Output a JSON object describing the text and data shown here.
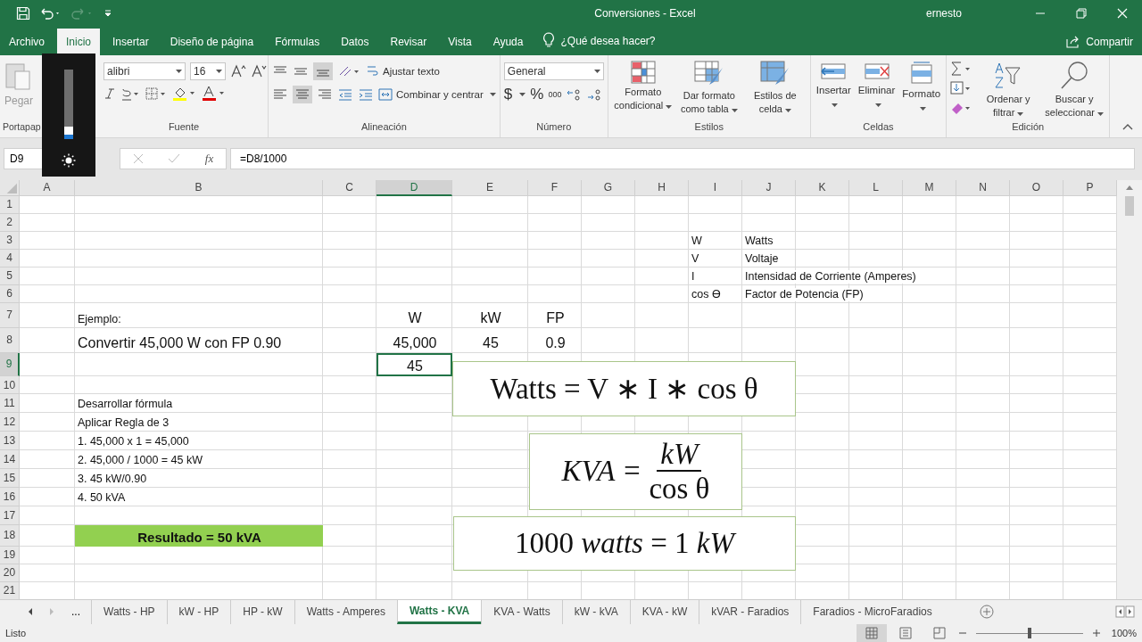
{
  "title_bar": {
    "document_title": "Conversiones  -  Excel",
    "user": "ernesto"
  },
  "ribbon_tabs": [
    {
      "label": "Archivo",
      "selected": false
    },
    {
      "label": "Inicio",
      "selected": true
    },
    {
      "label": "Insertar",
      "selected": false
    },
    {
      "label": "Diseño de página",
      "selected": false
    },
    {
      "label": "Fórmulas",
      "selected": false
    },
    {
      "label": "Datos",
      "selected": false
    },
    {
      "label": "Revisar",
      "selected": false
    },
    {
      "label": "Vista",
      "selected": false
    },
    {
      "label": "Ayuda",
      "selected": false
    }
  ],
  "tell_me": "¿Qué desea hacer?",
  "share": "Compartir",
  "ribbon": {
    "clipboard": {
      "paste": "Pegar",
      "group": "Portapap"
    },
    "font": {
      "name": "alibri",
      "size": "16",
      "group": "Fuente"
    },
    "alignment": {
      "wrap": "Ajustar texto",
      "merge": "Combinar y centrar",
      "group": "Alineación"
    },
    "number": {
      "format": "General",
      "currency": "$",
      "percent": "%",
      "thousands": "000",
      "group": "Número"
    },
    "styles": {
      "buttons": [
        "Formato condicional",
        "Dar formato como tabla",
        "Estilos de celda"
      ],
      "group": "Estilos"
    },
    "cells": {
      "buttons": [
        "Insertar",
        "Eliminar",
        "Formato"
      ],
      "group": "Celdas"
    },
    "editing": {
      "buttons": [
        "Ordenar y filtrar",
        "Buscar y seleccionar"
      ],
      "group": "Edición"
    }
  },
  "formula_bar": {
    "name_box": "D9",
    "function_label": "fx",
    "formula": "=D8/1000"
  },
  "columns": [
    {
      "label": "A",
      "selected": false
    },
    {
      "label": "B",
      "selected": false
    },
    {
      "label": "C",
      "selected": false
    },
    {
      "label": "D",
      "selected": true
    },
    {
      "label": "E",
      "selected": false
    },
    {
      "label": "F",
      "selected": false
    },
    {
      "label": "G",
      "selected": false
    },
    {
      "label": "H",
      "selected": false
    },
    {
      "label": "I",
      "selected": false
    },
    {
      "label": "J",
      "selected": false
    },
    {
      "label": "K",
      "selected": false
    },
    {
      "label": "L",
      "selected": false
    },
    {
      "label": "M",
      "selected": false
    },
    {
      "label": "N",
      "selected": false
    },
    {
      "label": "O",
      "selected": false
    },
    {
      "label": "P",
      "selected": false
    }
  ],
  "rows": [
    {
      "number": "1",
      "kind": "plain",
      "selected": false
    },
    {
      "number": "2",
      "kind": "plain",
      "selected": false
    },
    {
      "number": "3",
      "kind": "plain",
      "selected": false,
      "I": "W",
      "J": "Watts"
    },
    {
      "number": "4",
      "kind": "plain",
      "selected": false,
      "I": "V",
      "J": "Voltaje"
    },
    {
      "number": "5",
      "kind": "plain",
      "selected": false,
      "I": "I",
      "J": "Intensidad de Corriente (Amperes)"
    },
    {
      "number": "6",
      "kind": "plain",
      "selected": false,
      "I": "cos ϴ",
      "J": "Factor de Potencia (FP)"
    },
    {
      "number": "7",
      "kind": "header",
      "selected": false,
      "B": "Ejemplo:",
      "D": "W",
      "E": "kW",
      "F": "FP"
    },
    {
      "number": "8",
      "kind": "values",
      "selected": false,
      "B": "Convertir 45,000 W con FP 0.90",
      "D": "45,000",
      "E": "45",
      "F": "0.9"
    },
    {
      "number": "9",
      "kind": "values",
      "selected": true,
      "D": "45"
    },
    {
      "number": "10",
      "kind": "plain",
      "selected": false
    },
    {
      "number": "11",
      "kind": "plain",
      "selected": false,
      "B": "Desarrollar fórmula"
    },
    {
      "number": "12",
      "kind": "plain",
      "selected": false,
      "B": "Aplicar Regla de 3"
    },
    {
      "number": "13",
      "kind": "plain",
      "selected": false,
      "B": "1. 45,000 x 1 = 45,000"
    },
    {
      "number": "14",
      "kind": "plain",
      "selected": false,
      "B": "2. 45,000 / 1000 = 45 kW"
    },
    {
      "number": "15",
      "kind": "plain",
      "selected": false,
      "B": "3. 45 kW/0.90"
    },
    {
      "number": "16",
      "kind": "plain",
      "selected": false,
      "B": "4. 50 kVA"
    },
    {
      "number": "17",
      "kind": "plain",
      "selected": false
    },
    {
      "number": "18",
      "kind": "result",
      "selected": false,
      "B": "Resultado = 50 kVA"
    },
    {
      "number": "19",
      "kind": "plain",
      "selected": false
    },
    {
      "number": "20",
      "kind": "plain",
      "selected": false
    },
    {
      "number": "21",
      "kind": "plain",
      "selected": false
    }
  ],
  "equations": [
    {
      "kind": "inline",
      "text": "Watts = V ∗ I ∗  cos θ"
    },
    {
      "kind": "fraction",
      "left": "KVA =",
      "numerator": "kW",
      "denominator": "cos θ"
    },
    {
      "kind": "inline",
      "text": "1000 *watts* = 1 *kW*"
    }
  ],
  "sheet_tabs": {
    "more": "...",
    "tabs": [
      {
        "label": "Watts - HP",
        "selected": false
      },
      {
        "label": "kW - HP",
        "selected": false
      },
      {
        "label": "HP - kW",
        "selected": false
      },
      {
        "label": "Watts - Amperes",
        "selected": false
      },
      {
        "label": "Watts - KVA",
        "selected": true
      },
      {
        "label": "KVA - Watts",
        "selected": false
      },
      {
        "label": "kW - kVA",
        "selected": false
      },
      {
        "label": "KVA - kW",
        "selected": false
      },
      {
        "label": "kVAR - Faradios",
        "selected": false
      },
      {
        "label": "Faradios - MicroFaradios",
        "selected": false
      }
    ]
  },
  "status_bar": {
    "status": "Listo",
    "zoom": "100%",
    "zoom_slider": {
      "level": 0.5
    }
  },
  "brightness_overlay": {
    "level": 0.12
  }
}
